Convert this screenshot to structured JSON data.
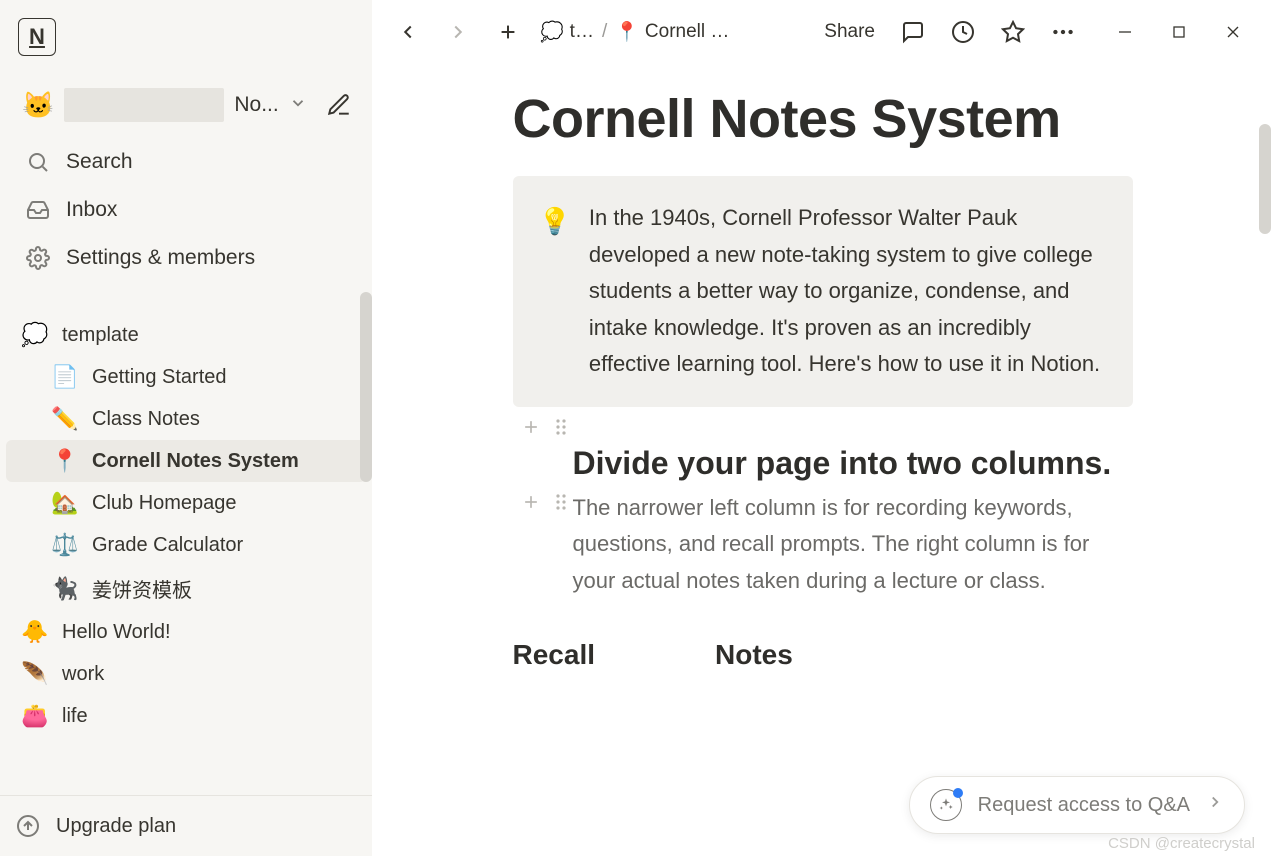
{
  "workspace": {
    "emoji": "🐱",
    "name_truncated": "No...",
    "compose_icon": "compose"
  },
  "top_actions": {
    "search": "Search",
    "inbox": "Inbox",
    "settings": "Settings & members"
  },
  "sidebar": {
    "sections": [
      {
        "emoji": "💭",
        "label": "template",
        "level": 1
      },
      {
        "emoji": "📄",
        "label": "Getting Started",
        "level": 2
      },
      {
        "emoji": "✏️",
        "label": "Class Notes",
        "level": 2
      },
      {
        "emoji": "📍",
        "label": "Cornell Notes System",
        "level": 2,
        "active": true
      },
      {
        "emoji": "🏡",
        "label": "Club Homepage",
        "level": 2
      },
      {
        "emoji": "⚖️",
        "label": "Grade Calculator",
        "level": 2
      },
      {
        "emoji": "🐈‍⬛",
        "label": "姜饼资模板",
        "level": 2
      },
      {
        "emoji": "🐥",
        "label": "Hello World!",
        "level": 1
      },
      {
        "emoji": "🪶",
        "label": "work",
        "level": 1
      },
      {
        "emoji": "👛",
        "label": "life",
        "level": 1
      }
    ],
    "footer": "Upgrade plan"
  },
  "topbar": {
    "share": "Share",
    "breadcrumb": {
      "seg1_emoji": "💭",
      "seg1_label": "t…",
      "sep": "/",
      "seg2_emoji": "📍",
      "seg2_label": "Cornell …"
    }
  },
  "page": {
    "title": "Cornell Notes System",
    "callout_emoji": "💡",
    "callout_text": "In the 1940s, Cornell Professor Walter Pauk developed a new note-taking system to give college students a better way to organize, condense, and intake knowledge. It's proven as an incredibly effective learning tool. Here's how to use it in Notion.",
    "h2": "Divide your page into two columns.",
    "para": "The narrower left column is for recording keywords, questions, and recall prompts. The right column is for your actual notes taken during a lecture or class.",
    "col1": "Recall",
    "col2": "Notes"
  },
  "qa": {
    "label": "Request access to Q&A"
  },
  "watermark": "CSDN @createcrystal"
}
